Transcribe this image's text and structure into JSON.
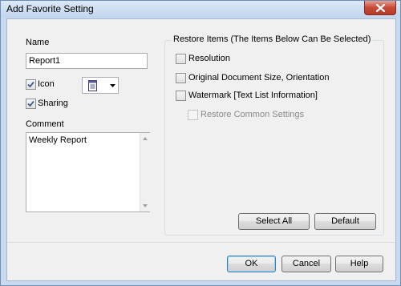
{
  "window": {
    "title": "Add Favorite Setting"
  },
  "name_section": {
    "label": "Name",
    "value": "Report1"
  },
  "icon_option": {
    "label": "Icon",
    "checked": true,
    "selected_icon": "document-icon"
  },
  "sharing_option": {
    "label": "Sharing",
    "checked": true
  },
  "comment_section": {
    "label": "Comment",
    "value": "Weekly Report"
  },
  "restore_group": {
    "title": "Restore Items (The Items Below Can Be Selected)",
    "items": [
      {
        "label": "Resolution",
        "checked": false,
        "enabled": true
      },
      {
        "label": "Original Document Size, Orientation",
        "checked": false,
        "enabled": true
      },
      {
        "label": "Watermark [Text List Information]",
        "checked": false,
        "enabled": true
      },
      {
        "label": "Restore Common Settings",
        "checked": false,
        "enabled": false
      }
    ],
    "select_all_label": "Select All",
    "default_label": "Default"
  },
  "footer": {
    "ok_label": "OK",
    "cancel_label": "Cancel",
    "help_label": "Help"
  },
  "colors": {
    "title_bar": "#c3d6ee",
    "close_button": "#c74a37",
    "dialog_bg": "#f0f0f0",
    "check_mark": "#3b5f8a"
  }
}
